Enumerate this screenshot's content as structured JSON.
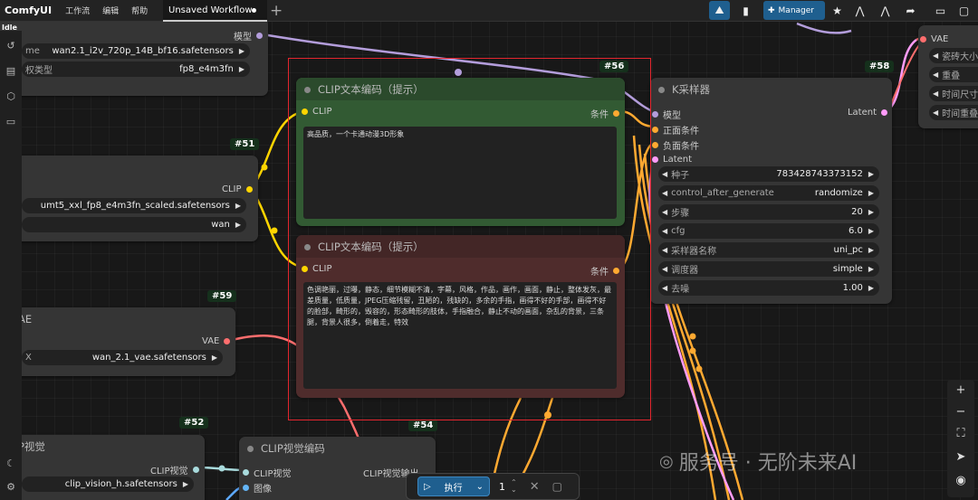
{
  "topbar": {
    "logo": "ComfyUI",
    "menu": [
      "工作流",
      "编辑",
      "帮助"
    ],
    "tab_title": "Unsaved Workflow",
    "manager_label": "Manager"
  },
  "status": {
    "idle": "Idle"
  },
  "nodes": {
    "model_loader": {
      "label_model": "模型",
      "row1_label": "me",
      "row1_value": "wan2.1_i2v_720p_14B_bf16.safetensors",
      "row2_label": "权类型",
      "row2_value": "fp8_e4m3fn"
    },
    "clip_loader": {
      "badge": "#51",
      "output_label": "CLIP",
      "row1_value": "umt5_xxl_fp8_e4m3fn_scaled.safetensors",
      "row2_value": "wan"
    },
    "vae_loader": {
      "badge": "#59",
      "title": "AE",
      "output_label": "VAE",
      "row1_label": "X",
      "row1_value": "wan_2.1_vae.safetensors"
    },
    "clip_vision_loader": {
      "badge": "#52",
      "title": "P视觉",
      "output_label": "CLIP视觉",
      "row1_value": "clip_vision_h.safetensors"
    },
    "positive": {
      "badge": "#56",
      "title": "CLIP文本编码（提示）",
      "input_label": "CLIP",
      "output_label": "条件",
      "text": "高品质，一个卡通动漫3D形象"
    },
    "negative": {
      "title": "CLIP文本编码（提示）",
      "input_label": "CLIP",
      "output_label": "条件",
      "text": "色调艳丽，过曝，静态，细节模糊不清，字幕，风格，作品，画作，画面，静止，整体发灰，最差质量，低质量，JPEG压缩残留，丑陋的，残缺的，多余的手指，画得不好的手部，画得不好的脸部，畸形的，毁容的，形态畸形的肢体，手指融合，静止不动的画面，杂乱的背景，三条腿，背景人很多，倒着走，特效"
    },
    "ksampler": {
      "badge": "#58",
      "title": "K采样器",
      "inputs": [
        "模型",
        "正面条件",
        "负面条件",
        "Latent"
      ],
      "output_label": "Latent",
      "widgets": [
        {
          "label": "种子",
          "value": "783428743373152"
        },
        {
          "label": "control_after_generate",
          "value": "randomize"
        },
        {
          "label": "步骤",
          "value": "20"
        },
        {
          "label": "cfg",
          "value": "6.0"
        },
        {
          "label": "采样器名称",
          "value": "uni_pc"
        },
        {
          "label": "调度器",
          "value": "simple"
        },
        {
          "label": "去噪",
          "value": "1.00"
        }
      ]
    },
    "vae_decode_partial": {
      "input_label": "VAE",
      "widgets": [
        "瓷砖大小",
        "重叠",
        "时间尺寸",
        "时间重叠"
      ]
    },
    "clip_vision_encode": {
      "badge": "#54",
      "title": "CLIP视觉编码",
      "input1": "CLIP视觉",
      "input2": "图像",
      "output_label": "CLIP视觉输出"
    }
  },
  "runbar": {
    "run_label": "执行",
    "count": "1"
  },
  "watermark": "服务号 · 无阶未来AI",
  "colors": {
    "clip": "#ffd500",
    "conditioning": "#ffa931",
    "vae": "#ff6e6e",
    "latent": "#ff9cf9",
    "model": "#b39ddb",
    "clip_vision": "#a8dadc",
    "accent": "#1f5f8f",
    "selection": "#e3262e",
    "positive_node": "#325a33",
    "negative_node": "#4f2c2c"
  }
}
